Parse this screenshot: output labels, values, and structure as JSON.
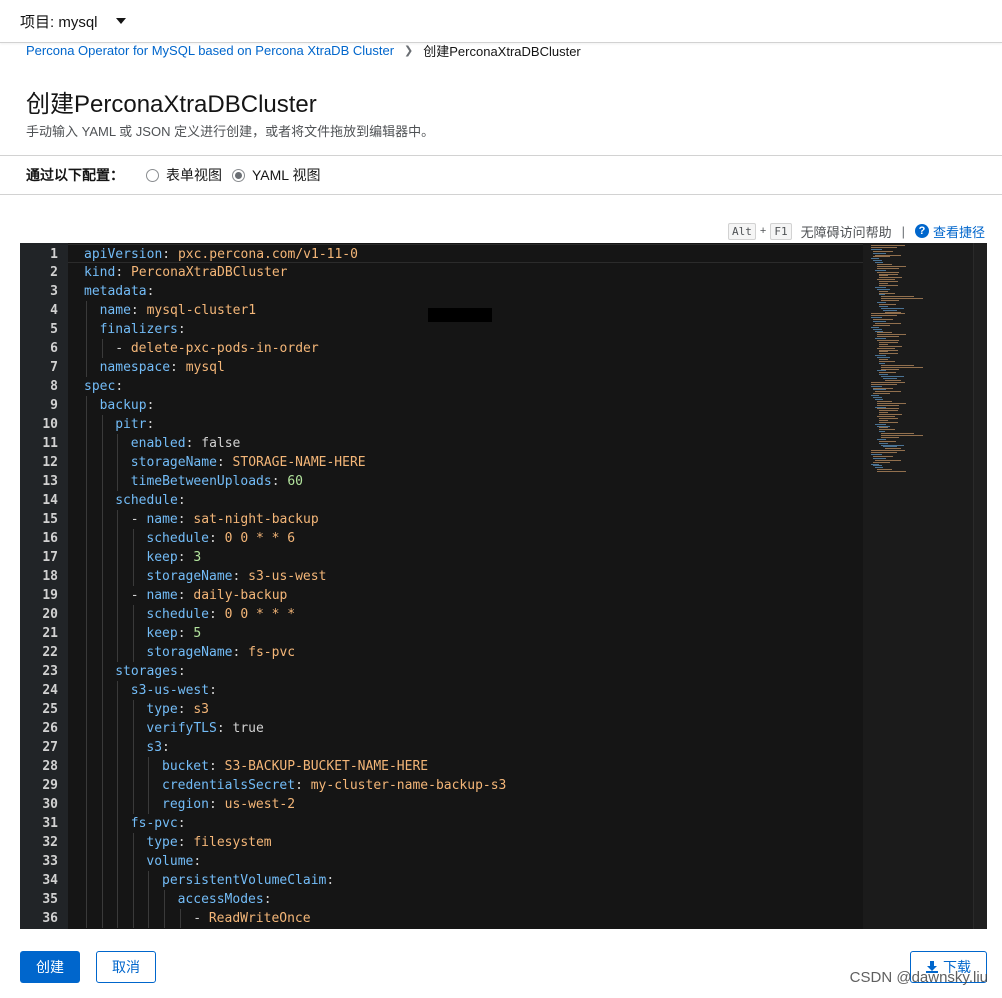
{
  "project_bar": {
    "label": "项目: mysql"
  },
  "breadcrumb": {
    "parent": "Percona Operator for MySQL based on Percona XtraDB Cluster",
    "current": "创建PerconaXtraDBCluster"
  },
  "page": {
    "title": "创建PerconaXtraDBCluster",
    "description": "手动输入 YAML 或 JSON 定义进行创建，或者将文件拖放到编辑器中。"
  },
  "config": {
    "label": "通过以下配置：",
    "options": [
      {
        "label": "表单视图",
        "checked": false
      },
      {
        "label": "YAML 视图",
        "checked": true
      }
    ]
  },
  "shortcuts": {
    "key1": "Alt",
    "plus": "+",
    "key2": "F1",
    "text": "无障碍访问帮助",
    "divider": "|",
    "help_icon": "?",
    "link": "查看捷径"
  },
  "editor": {
    "lines": [
      {
        "n": "1",
        "indent": 0,
        "key": "apiVersion",
        "val": "pxc.percona.com/v1-11-0",
        "vt": "v"
      },
      {
        "n": "2",
        "indent": 0,
        "key": "kind",
        "val": "PerconaXtraDBCluster",
        "vt": "v"
      },
      {
        "n": "3",
        "indent": 0,
        "key": "metadata",
        "val": "",
        "vt": ""
      },
      {
        "n": "4",
        "indent": 1,
        "key": "name",
        "val": "mysql-cluster1",
        "vt": "v"
      },
      {
        "n": "5",
        "indent": 1,
        "key": "finalizers",
        "val": "",
        "vt": ""
      },
      {
        "n": "6",
        "indent": 2,
        "dash": true,
        "key": "",
        "val": "delete-pxc-pods-in-order",
        "vt": "v"
      },
      {
        "n": "7",
        "indent": 1,
        "key": "namespace",
        "val": "mysql",
        "vt": "v"
      },
      {
        "n": "8",
        "indent": 0,
        "key": "spec",
        "val": "",
        "vt": ""
      },
      {
        "n": "9",
        "indent": 1,
        "key": "backup",
        "val": "",
        "vt": ""
      },
      {
        "n": "10",
        "indent": 2,
        "key": "pitr",
        "val": "",
        "vt": ""
      },
      {
        "n": "11",
        "indent": 3,
        "key": "enabled",
        "val": "false",
        "vt": "b"
      },
      {
        "n": "12",
        "indent": 3,
        "key": "storageName",
        "val": "STORAGE-NAME-HERE",
        "vt": "v"
      },
      {
        "n": "13",
        "indent": 3,
        "key": "timeBetweenUploads",
        "val": "60",
        "vt": "n"
      },
      {
        "n": "14",
        "indent": 2,
        "key": "schedule",
        "val": "",
        "vt": ""
      },
      {
        "n": "15",
        "indent": 3,
        "dash": true,
        "key": "name",
        "val": "sat-night-backup",
        "vt": "v"
      },
      {
        "n": "16",
        "indent": 4,
        "key": "schedule",
        "val": "0 0 * * 6",
        "vt": "v"
      },
      {
        "n": "17",
        "indent": 4,
        "key": "keep",
        "val": "3",
        "vt": "n"
      },
      {
        "n": "18",
        "indent": 4,
        "key": "storageName",
        "val": "s3-us-west",
        "vt": "v"
      },
      {
        "n": "19",
        "indent": 3,
        "dash": true,
        "key": "name",
        "val": "daily-backup",
        "vt": "v"
      },
      {
        "n": "20",
        "indent": 4,
        "key": "schedule",
        "val": "0 0 * * *",
        "vt": "v"
      },
      {
        "n": "21",
        "indent": 4,
        "key": "keep",
        "val": "5",
        "vt": "n"
      },
      {
        "n": "22",
        "indent": 4,
        "key": "storageName",
        "val": "fs-pvc",
        "vt": "v"
      },
      {
        "n": "23",
        "indent": 2,
        "key": "storages",
        "val": "",
        "vt": ""
      },
      {
        "n": "24",
        "indent": 3,
        "key": "s3-us-west",
        "val": "",
        "vt": ""
      },
      {
        "n": "25",
        "indent": 4,
        "key": "type",
        "val": "s3",
        "vt": "v"
      },
      {
        "n": "26",
        "indent": 4,
        "key": "verifyTLS",
        "val": "true",
        "vt": "b"
      },
      {
        "n": "27",
        "indent": 4,
        "key": "s3",
        "val": "",
        "vt": ""
      },
      {
        "n": "28",
        "indent": 5,
        "key": "bucket",
        "val": "S3-BACKUP-BUCKET-NAME-HERE",
        "vt": "v"
      },
      {
        "n": "29",
        "indent": 5,
        "key": "credentialsSecret",
        "val": "my-cluster-name-backup-s3",
        "vt": "v"
      },
      {
        "n": "30",
        "indent": 5,
        "key": "region",
        "val": "us-west-2",
        "vt": "v"
      },
      {
        "n": "31",
        "indent": 3,
        "key": "fs-pvc",
        "val": "",
        "vt": ""
      },
      {
        "n": "32",
        "indent": 4,
        "key": "type",
        "val": "filesystem",
        "vt": "v"
      },
      {
        "n": "33",
        "indent": 4,
        "key": "volume",
        "val": "",
        "vt": ""
      },
      {
        "n": "34",
        "indent": 5,
        "key": "persistentVolumeClaim",
        "val": "",
        "vt": ""
      },
      {
        "n": "35",
        "indent": 6,
        "key": "accessModes",
        "val": "",
        "vt": ""
      },
      {
        "n": "36",
        "indent": 7,
        "dash": true,
        "key": "",
        "val": "ReadWriteOnce",
        "vt": "v"
      }
    ]
  },
  "actions": {
    "create": "创建",
    "cancel": "取消",
    "download": "下载"
  },
  "watermark": "CSDN @dawnsky.liu",
  "colors": {
    "accent": "#0066cc",
    "editor_bg": "#151515",
    "yaml_key": "#73bcf7",
    "yaml_string": "#f4b678",
    "yaml_number": "#b2e39c"
  }
}
